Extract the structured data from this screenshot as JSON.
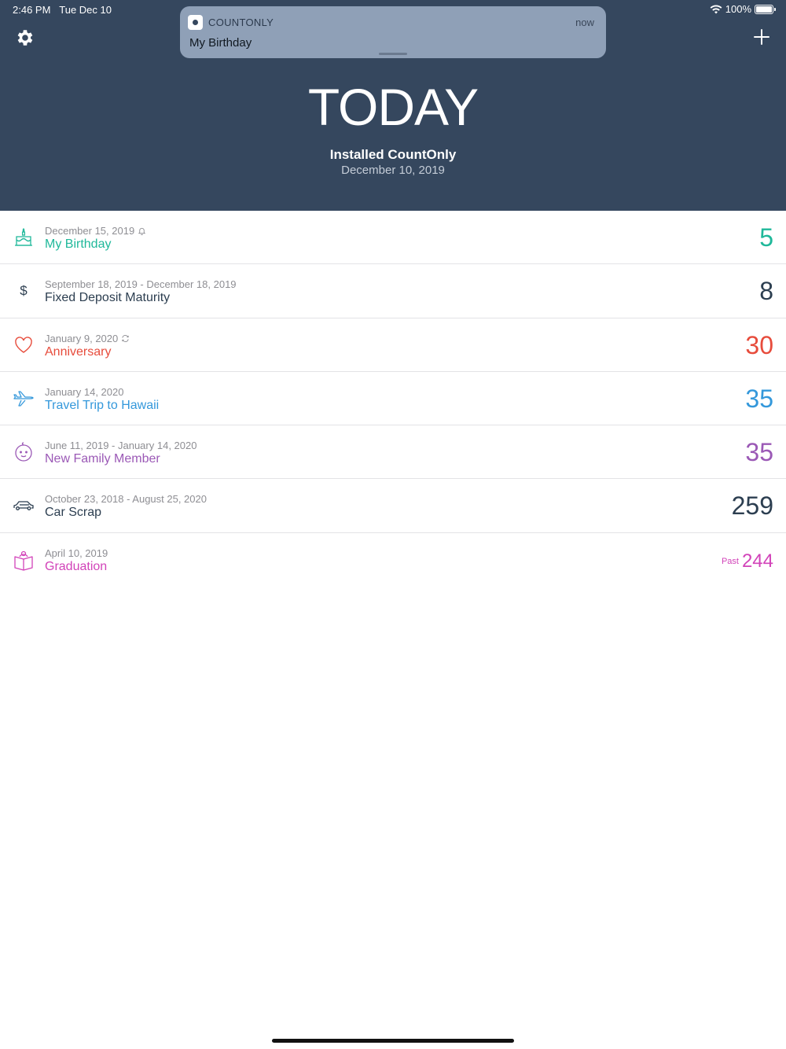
{
  "status": {
    "time": "2:46 PM",
    "date": "Tue Dec 10",
    "battery": "100%"
  },
  "notification": {
    "app": "COUNTONLY",
    "time": "now",
    "title": "My Birthday"
  },
  "header": {
    "title": "TODAY",
    "subtitle": "Installed CountOnly",
    "date": "December 10, 2019"
  },
  "events": [
    {
      "date": "December 15, 2019",
      "title": "My Birthday",
      "count": "5",
      "prefix": "",
      "color": "#1fb89a",
      "icon": "birthday-cake-icon",
      "flag": "bell-icon"
    },
    {
      "date": "September 18, 2019 - December 18, 2019",
      "title": "Fixed Deposit Maturity",
      "count": "8",
      "prefix": "",
      "color": "#2c3e50",
      "icon": "dollar-icon",
      "flag": ""
    },
    {
      "date": "January 9, 2020",
      "title": "Anniversary",
      "count": "30",
      "prefix": "",
      "color": "#e74c3c",
      "icon": "heart-icon",
      "flag": "repeat-icon"
    },
    {
      "date": "January 14, 2020",
      "title": "Travel Trip to Hawaii",
      "count": "35",
      "prefix": "",
      "color": "#3498db",
      "icon": "airplane-icon",
      "flag": ""
    },
    {
      "date": "June 11, 2019 - January 14, 2020",
      "title": "New Family Member",
      "count": "35",
      "prefix": "",
      "color": "#9b59b6",
      "icon": "baby-face-icon",
      "flag": ""
    },
    {
      "date": "October 23, 2018 - August 25, 2020",
      "title": "Car Scrap",
      "count": "259",
      "prefix": "",
      "color": "#2c3e50",
      "icon": "car-icon",
      "flag": ""
    },
    {
      "date": "April 10, 2019",
      "title": "Graduation",
      "count": "244",
      "prefix": "Past",
      "color": "#d243b9",
      "icon": "graduation-book-icon",
      "flag": ""
    }
  ]
}
